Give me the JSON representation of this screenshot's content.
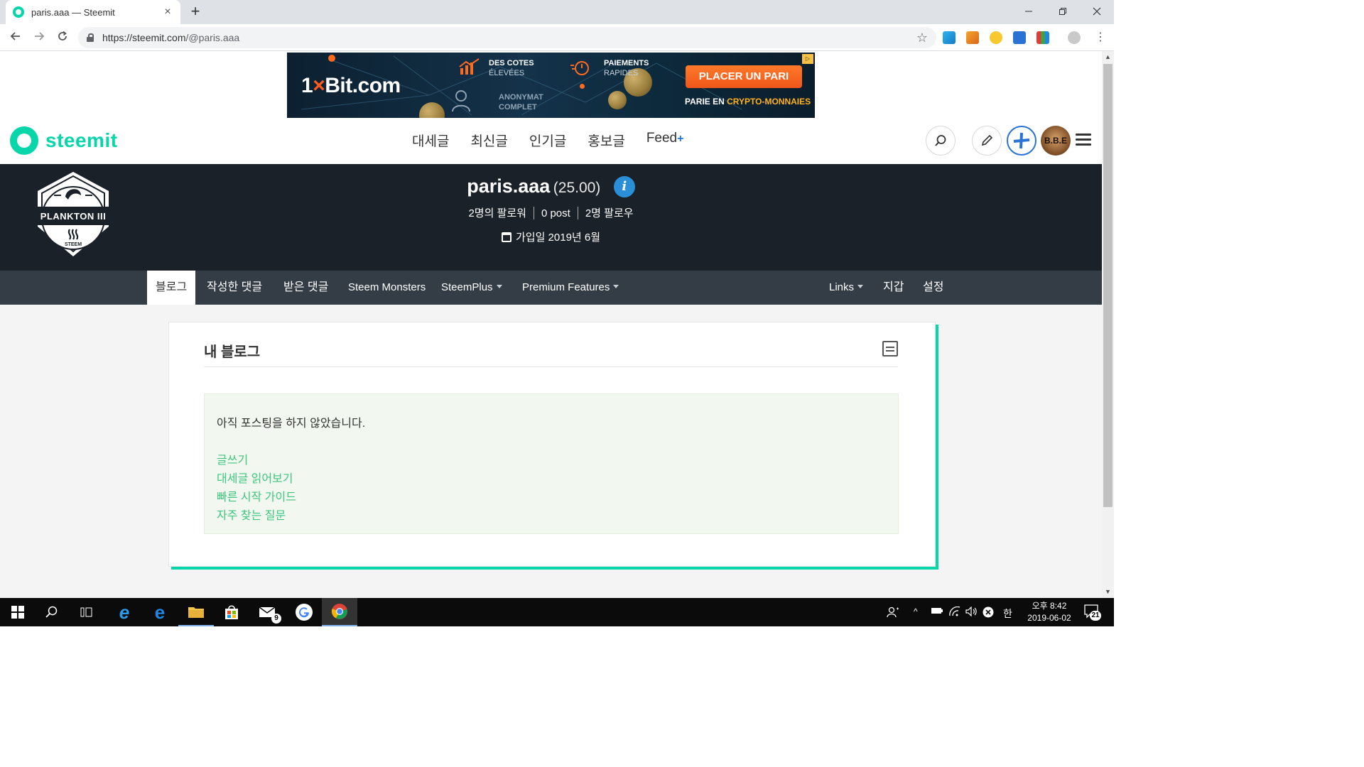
{
  "browser": {
    "tab_title": "paris.aaa — Steemit",
    "url_host": "https://steemit.com",
    "url_path": "/@paris.aaa",
    "new_tab": "+",
    "close_tab": "×"
  },
  "ad": {
    "brand_prefix": "1",
    "brand_x": "×",
    "brand_suffix": "Bit.com",
    "feature1_title": "DES COTES",
    "feature1_sub": "ÉLEVÉES",
    "feature2_title": "PAIEMENTS",
    "feature2_sub": "RAPIDES",
    "feature3_title": "ANONYMAT",
    "feature3_sub": "COMPLET",
    "cta": "PLACER UN PARI",
    "tagline_prefix": "PARIE EN ",
    "tagline_highlight": "CRYPTO-MONNAIES"
  },
  "site": {
    "logo_text": "steemit",
    "nav": [
      "대세글",
      "최신글",
      "인기글",
      "홍보글",
      "Feed"
    ],
    "feed_plus": "+",
    "avatar_text": "B.B.E"
  },
  "profile": {
    "badge_label": "PLANKTON III",
    "badge_sub": "STEEM",
    "name": "paris.aaa",
    "reputation": "(25.00)",
    "info_icon": "i",
    "followers": "2명의 팔로워",
    "posts": "0 post",
    "following": "2명 팔로우",
    "joined": "가입일 2019년 6월"
  },
  "tabs": {
    "left": [
      "블로그",
      "작성한 댓글",
      "받은 댓글",
      "Steem Monsters",
      "SteemPlus",
      "Premium Features"
    ],
    "right": [
      "Links",
      "지갑",
      "설정"
    ],
    "active": "블로그"
  },
  "blog": {
    "title": "내 블로그",
    "empty_message": "아직 포스팅을 하지 않았습니다.",
    "links": [
      "글쓰기",
      "대세글 읽어보기",
      "빠른 시작 가이드",
      "자주 찾는 질문"
    ]
  },
  "taskbar": {
    "mail_badge": "9",
    "ime": "한",
    "time": "오후 8:42",
    "date": "2019-06-02",
    "notifications": "21"
  },
  "colors": {
    "steemit_green": "#06d6a9",
    "link_green": "#3ec67f",
    "profile_bg": "#1b2128",
    "tabs_bg": "#343d46"
  }
}
